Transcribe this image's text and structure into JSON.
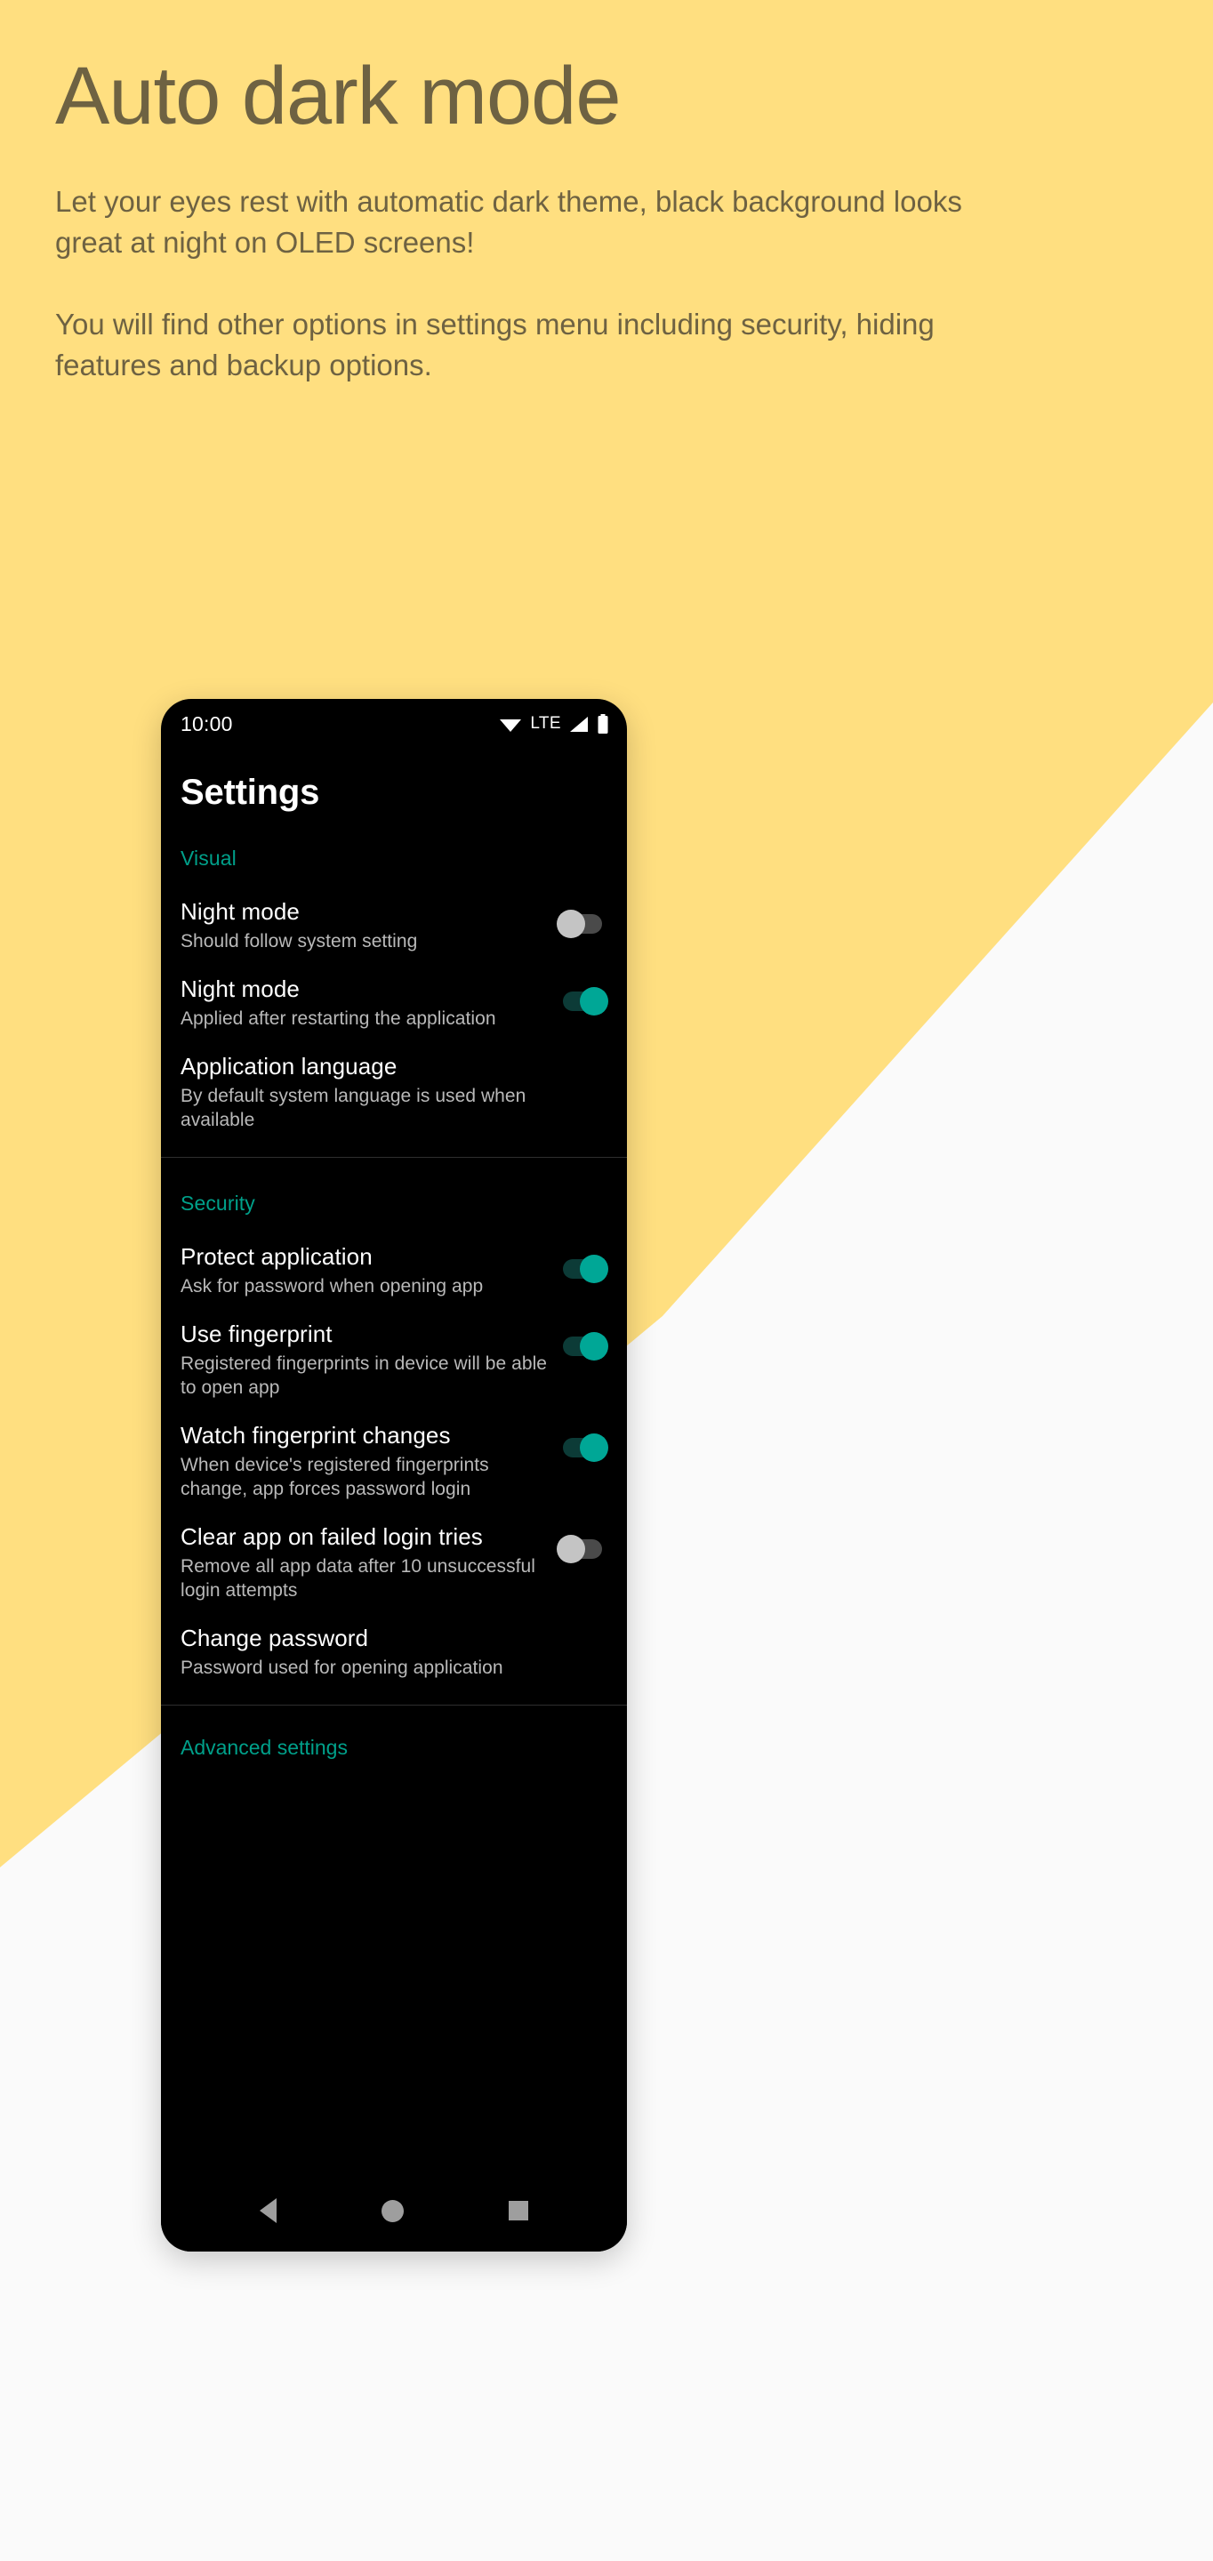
{
  "page": {
    "title": "Auto dark mode",
    "paragraphs": [
      "Let your eyes rest with automatic dark theme, black background looks great at night on OLED screens!",
      "You will find other options in settings menu including security, hiding features and backup options."
    ],
    "colors": {
      "background_yellow": "#FFDF80",
      "background_white": "#FAFAFA",
      "header_text": "#6E6242",
      "accent_teal": "#00A08A",
      "toggle_on": "#00A796",
      "phone_screen": "#000000"
    }
  },
  "phone": {
    "status_bar": {
      "time": "10:00",
      "network_label": "LTE",
      "icons": [
        "wifi-icon",
        "signal-icon",
        "battery-icon"
      ]
    },
    "app_title": "Settings",
    "sections": [
      {
        "header": "Visual",
        "rows": [
          {
            "title": "Night mode",
            "subtitle": "Should follow system setting",
            "control": "toggle",
            "state": "off"
          },
          {
            "title": "Night mode",
            "subtitle": "Applied after restarting the application",
            "control": "toggle",
            "state": "on"
          },
          {
            "title": "Application language",
            "subtitle": "By default system language is used when available",
            "control": "none",
            "state": ""
          }
        ]
      },
      {
        "header": "Security",
        "rows": [
          {
            "title": "Protect application",
            "subtitle": "Ask for password when opening app",
            "control": "toggle",
            "state": "on"
          },
          {
            "title": "Use fingerprint",
            "subtitle": "Registered fingerprints in device will be able to open app",
            "control": "toggle",
            "state": "on"
          },
          {
            "title": "Watch fingerprint changes",
            "subtitle": "When device's registered fingerprints change, app forces password login",
            "control": "toggle",
            "state": "on"
          },
          {
            "title": "Clear app on failed login tries",
            "subtitle": "Remove all app data after 10 unsuccessful login attempts",
            "control": "toggle",
            "state": "off"
          },
          {
            "title": "Change password",
            "subtitle": "Password used for opening application",
            "control": "none",
            "state": ""
          }
        ]
      }
    ],
    "next_section_header": "Advanced settings",
    "nav_bar": {
      "back": "back-icon",
      "home": "home-icon",
      "recents": "recents-icon"
    }
  }
}
